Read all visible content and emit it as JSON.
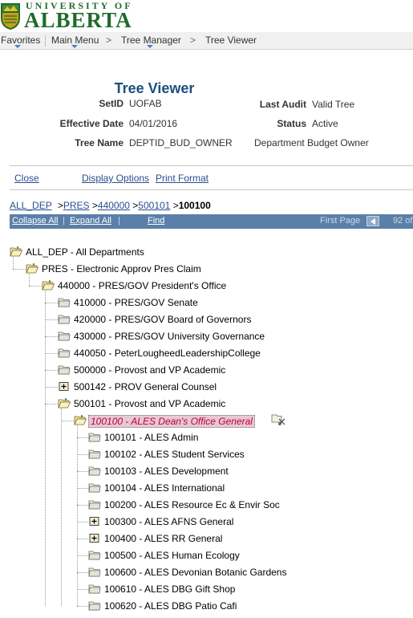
{
  "branding": {
    "line1": "UNIVERSITY OF",
    "line2": "ALBERTA"
  },
  "nav": {
    "favorites": "Favorites",
    "main_menu": "Main Menu",
    "tree_manager": "Tree Manager",
    "tree_viewer": "Tree Viewer",
    "separator": ">"
  },
  "page": {
    "title": "Tree Viewer"
  },
  "fields": {
    "setid_label": "SetID",
    "setid_value": "UOFAB",
    "last_audit_label": "Last Audit",
    "last_audit_value": "Valid Tree",
    "effective_date_label": "Effective Date",
    "effective_date_value": "04/01/2016",
    "status_label": "Status",
    "status_value": "Active",
    "tree_name_label": "Tree Name",
    "tree_name_value": "DEPTID_BUD_OWNER",
    "tree_description": "Department Budget Owner"
  },
  "actions": {
    "close": "Close",
    "display_options": "Display Options",
    "print_format": "Print Format"
  },
  "breadcrumb": {
    "items": [
      "ALL_DEP",
      "PRES",
      "440000",
      "500101"
    ],
    "current": "100100",
    "sep": ">"
  },
  "toolbar": {
    "collapse_all": "Collapse All",
    "expand_all": "Expand All",
    "find": "Find",
    "first_page": "First Page",
    "page_count": "92 of",
    "sep": "|"
  },
  "tree": {
    "nodes": [
      {
        "label": "ALL_DEP - All Departments",
        "icon": "folder-open-icon"
      },
      {
        "label": "PRES - Electronic Approv Pres Claim",
        "icon": "folder-open-icon"
      },
      {
        "label": "440000 - PRES/GOV President's Office",
        "icon": "folder-open-icon"
      },
      {
        "label": "410000 - PRES/GOV Senate",
        "icon": "folder-icon"
      },
      {
        "label": "420000 - PRES/GOV Board of Governors",
        "icon": "folder-icon"
      },
      {
        "label": "430000 - PRES/GOV University Governance",
        "icon": "folder-icon"
      },
      {
        "label": "440050 - PeterLougheedLeadershipCollege",
        "icon": "folder-icon"
      },
      {
        "label": "500000 - Provost and VP Academic",
        "icon": "folder-icon"
      },
      {
        "label": "500142 - PROV General Counsel",
        "icon": "expand-plus-icon"
      },
      {
        "label": "500101 - Provost and VP Academic",
        "icon": "folder-open-icon"
      },
      {
        "label": "100100 - ALES Dean's Office General",
        "icon": "folder-open-icon",
        "selected": true
      },
      {
        "label": "100101 - ALES Admin",
        "icon": "folder-icon"
      },
      {
        "label": "100102 - ALES Student Services",
        "icon": "folder-icon"
      },
      {
        "label": "100103 - ALES Development",
        "icon": "folder-icon"
      },
      {
        "label": "100104 - ALES International",
        "icon": "folder-icon"
      },
      {
        "label": "100200 - ALES Resource Ec & Envir Soc",
        "icon": "folder-icon"
      },
      {
        "label": "100300 - ALES AFNS General",
        "icon": "expand-plus-icon"
      },
      {
        "label": "100400 - ALES RR General",
        "icon": "expand-plus-icon"
      },
      {
        "label": "100500 - ALES Human Ecology",
        "icon": "folder-icon"
      },
      {
        "label": "100600 - ALES Devonian Botanic Gardens",
        "icon": "folder-icon"
      },
      {
        "label": "100610 - ALES DBG Gift Shop",
        "icon": "folder-icon"
      },
      {
        "label": "100620 - ALES DBG Patio Cafi",
        "icon": "folder-icon"
      }
    ],
    "cut_icon": "cut-node-icon"
  }
}
